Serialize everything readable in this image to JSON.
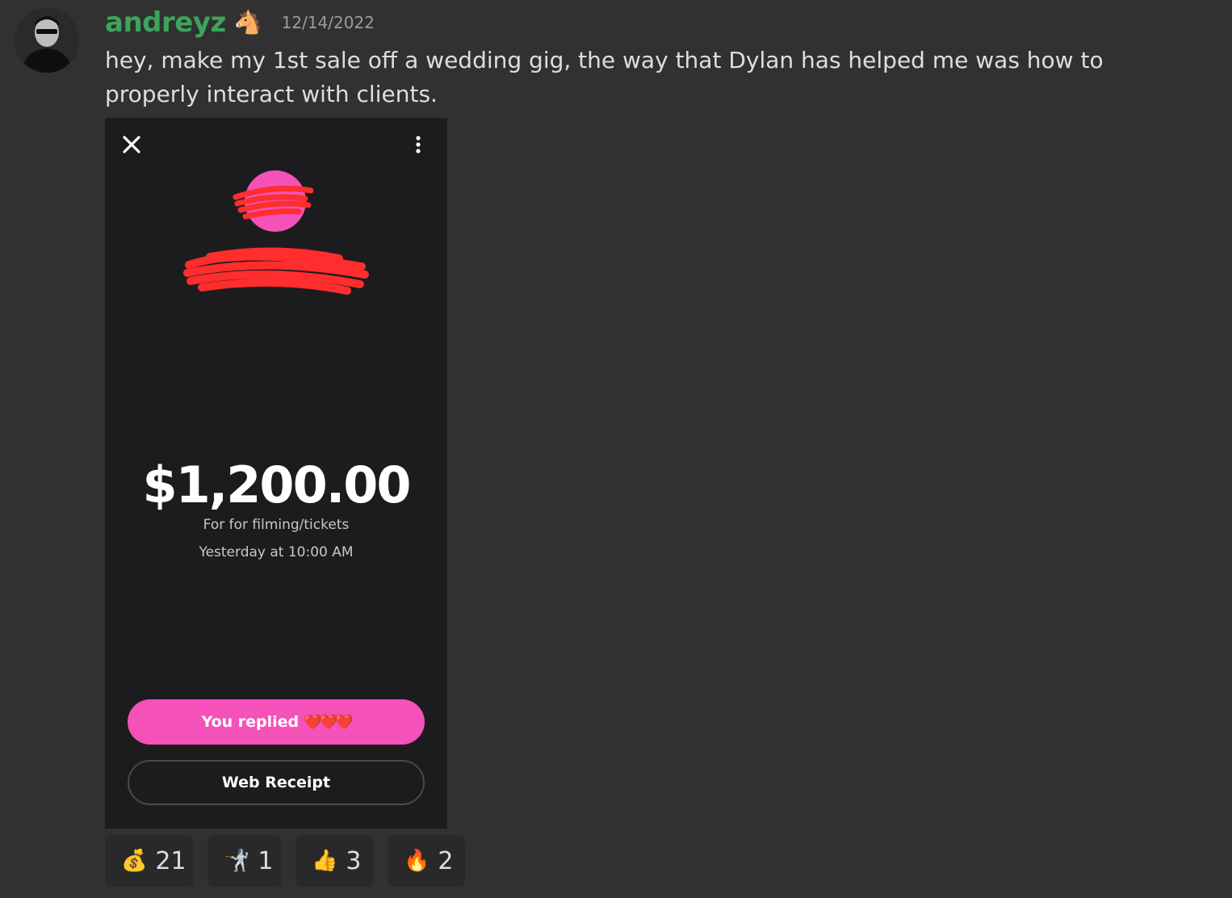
{
  "message": {
    "author": "andreyz",
    "role_icon": "horse-icon",
    "role_glyph": "🐴",
    "timestamp": "12/14/2022",
    "text": "hey, make my 1st sale off a wedding gig, the way that Dylan has helped me was how to properly interact with clients.",
    "username_color": "#3ba55c"
  },
  "attachment": {
    "top_bar": {
      "close_icon": "close-icon",
      "more_icon": "more-vertical-icon"
    },
    "payment": {
      "amount": "$1,200.00",
      "note": "For for filming/tickets",
      "time": "Yesterday at 10:00 AM"
    },
    "replied_button": {
      "label": "You replied",
      "hearts": "❤️❤️❤️",
      "color": "#f452b8"
    },
    "receipt_button": {
      "label": "Web Receipt"
    }
  },
  "reactions": [
    {
      "emoji": "💰",
      "icon": "money-bag-icon",
      "count": "21"
    },
    {
      "emoji": "🤺",
      "icon": "fencer-icon",
      "count": "1"
    },
    {
      "emoji": "👍",
      "icon": "thumbs-up-icon",
      "count": "3"
    },
    {
      "emoji": "🔥",
      "icon": "fire-icon",
      "count": "2"
    }
  ]
}
